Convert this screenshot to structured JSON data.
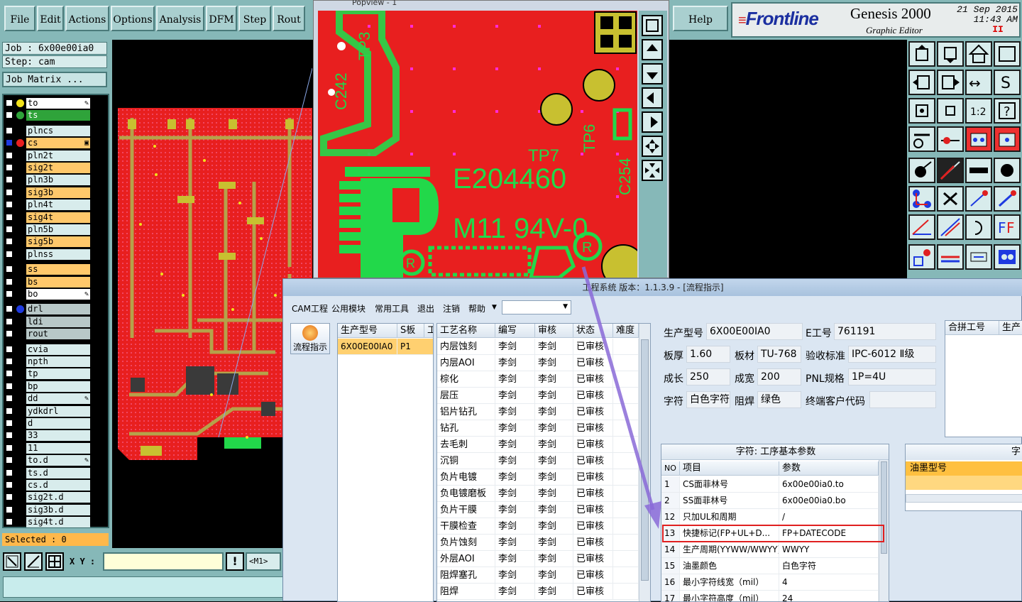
{
  "menu": {
    "items": [
      "File",
      "Edit",
      "Actions",
      "Options",
      "Analysis",
      "DFM",
      "Step",
      "Rout"
    ],
    "help": "Help"
  },
  "logo": {
    "brand_a": "Fr",
    "brand_b": "ontline",
    "product": "Genesis 2000",
    "subtitle": "Graphic Editor",
    "date": "21 Sep 2015",
    "time": "11:43 AM"
  },
  "job": {
    "job_label": "Job : 6x00e00ia0",
    "step_label": "Step: cam",
    "matrix_button": "Job Matrix ..."
  },
  "layers": [
    {
      "name": "to",
      "style": "hi",
      "dot": "#f2e21a",
      "flag": "✎"
    },
    {
      "name": "ts",
      "style": "tsb",
      "dot": "#2fa33a",
      "flag": ""
    },
    {
      "name": "plncs",
      "style": "pln",
      "dot": "",
      "flag": ""
    },
    {
      "name": "cs",
      "style": "sig",
      "dot": "#e81f1f",
      "flag": "▣",
      "active": true
    },
    {
      "name": "pln2t",
      "style": "pln",
      "dot": "",
      "flag": ""
    },
    {
      "name": "sig2t",
      "style": "sig",
      "dot": "",
      "flag": ""
    },
    {
      "name": "pln3b",
      "style": "pln",
      "dot": "",
      "flag": ""
    },
    {
      "name": "sig3b",
      "style": "sig",
      "dot": "",
      "flag": ""
    },
    {
      "name": "pln4t",
      "style": "pln",
      "dot": "",
      "flag": ""
    },
    {
      "name": "sig4t",
      "style": "sig",
      "dot": "",
      "flag": ""
    },
    {
      "name": "pln5b",
      "style": "pln",
      "dot": "",
      "flag": ""
    },
    {
      "name": "sig5b",
      "style": "sig",
      "dot": "",
      "flag": ""
    },
    {
      "name": "plnss",
      "style": "pln",
      "dot": "",
      "flag": ""
    },
    {
      "name": "ss",
      "style": "sig",
      "dot": "",
      "flag": ""
    },
    {
      "name": "bs",
      "style": "sig",
      "dot": "",
      "flag": ""
    },
    {
      "name": "bo",
      "style": "hi",
      "dot": "",
      "flag": "✎"
    },
    {
      "name": "drl",
      "style": "drl",
      "dot": "#1e3ae0",
      "flag": ""
    },
    {
      "name": "ldi",
      "style": "drl",
      "dot": "",
      "flag": ""
    },
    {
      "name": "rout",
      "style": "drl",
      "dot": "",
      "flag": ""
    },
    {
      "name": "cvia",
      "style": "pln",
      "dot": "",
      "flag": ""
    },
    {
      "name": "npth",
      "style": "pln",
      "dot": "",
      "flag": ""
    },
    {
      "name": "tp",
      "style": "pln",
      "dot": "",
      "flag": ""
    },
    {
      "name": "bp",
      "style": "pln",
      "dot": "",
      "flag": ""
    },
    {
      "name": "dd",
      "style": "pln",
      "dot": "",
      "flag": "✎"
    },
    {
      "name": "ydkdrl",
      "style": "pln",
      "dot": "",
      "flag": ""
    },
    {
      "name": "d",
      "style": "pln",
      "dot": "",
      "flag": ""
    },
    {
      "name": "33",
      "style": "pln",
      "dot": "",
      "flag": ""
    },
    {
      "name": "11",
      "style": "pln",
      "dot": "",
      "flag": ""
    },
    {
      "name": "to.d",
      "style": "pln",
      "dot": "",
      "flag": "✎"
    },
    {
      "name": "ts.d",
      "style": "pln",
      "dot": "",
      "flag": ""
    },
    {
      "name": "cs.d",
      "style": "pln",
      "dot": "",
      "flag": ""
    },
    {
      "name": "sig2t.d",
      "style": "pln",
      "dot": "",
      "flag": ""
    },
    {
      "name": "sig3b.d",
      "style": "pln",
      "dot": "",
      "flag": ""
    },
    {
      "name": "sig4t.d",
      "style": "pln",
      "dot": "",
      "flag": ""
    }
  ],
  "status": {
    "selected": "Selected : 0",
    "xy_label": "X Y :",
    "mode_label": "<M1>"
  },
  "popview": {
    "title": "Popview - 1",
    "board_text_1": "E204460",
    "board_text_2": "M11 94V-0",
    "refs": [
      "TP3",
      "C242",
      "TP7",
      "TP6",
      "C254"
    ]
  },
  "cam": {
    "title": "工程系统   版本：1.1.3.9 - [流程指示]",
    "menu": [
      "CAM工程",
      "公用模块",
      "常用工具",
      "退出",
      "注销",
      "帮助"
    ],
    "flow_button": "流程指示",
    "model_grid": {
      "headers": [
        "生产型号",
        "S板",
        "工"
      ],
      "rows": [
        [
          "6X00E00IA0",
          "P1"
        ]
      ]
    },
    "process_grid": {
      "headers": [
        "工艺名称",
        "编写",
        "审核",
        "状态",
        "难度"
      ],
      "rows": [
        [
          "内层蚀刻",
          "李剑",
          "李剑",
          "已审核"
        ],
        [
          "内层AOI",
          "李剑",
          "李剑",
          "已审核"
        ],
        [
          "棕化",
          "李剑",
          "李剑",
          "已审核"
        ],
        [
          "层压",
          "李剑",
          "李剑",
          "已审核"
        ],
        [
          "铝片钻孔",
          "李剑",
          "李剑",
          "已审核"
        ],
        [
          "钻孔",
          "李剑",
          "李剑",
          "已审核"
        ],
        [
          "去毛刺",
          "李剑",
          "李剑",
          "已审核"
        ],
        [
          "沉铜",
          "李剑",
          "李剑",
          "已审核"
        ],
        [
          "负片电镀",
          "李剑",
          "李剑",
          "已审核"
        ],
        [
          "负电镀磨板",
          "李剑",
          "李剑",
          "已审核"
        ],
        [
          "负片干膜",
          "李剑",
          "李剑",
          "已审核"
        ],
        [
          "干膜检查",
          "李剑",
          "李剑",
          "已审核"
        ],
        [
          "负片蚀刻",
          "李剑",
          "李剑",
          "已审核"
        ],
        [
          "外层AOI",
          "李剑",
          "李剑",
          "已审核"
        ],
        [
          "阻焊塞孔",
          "李剑",
          "李剑",
          "已审核"
        ],
        [
          "阻焊",
          "李剑",
          "李剑",
          "已审核"
        ]
      ]
    },
    "detail": {
      "prod_model_label": "生产型号",
      "prod_model": "6X00E00IA0",
      "e_no_label": "E工号",
      "e_no": "761191",
      "thick_label": "板厚",
      "thick": "1.60",
      "material_label": "板材",
      "material": "TU-768",
      "std_label": "验收标准",
      "std": "IPC-6012 Ⅱ级",
      "len_label": "成长",
      "len": "250",
      "wid_label": "成宽",
      "wid": "200",
      "pnl_label": "PNL规格",
      "pnl": "1P=4U",
      "char_label": "字符",
      "char": "白色字符",
      "mask_label": "阻焊",
      "mask": "绿色",
      "client_label": "终端客户代码",
      "client": ""
    },
    "merge_headers": [
      "合拼工号",
      "生产"
    ],
    "param_grid": {
      "title": "字符: 工序基本参数",
      "headers": [
        "NO",
        "项目",
        "参数"
      ],
      "rows": [
        [
          "1",
          "CS面菲林号",
          "6x00e00ia0.to"
        ],
        [
          "2",
          "SS面菲林号",
          "6x00e00ia0.bo"
        ],
        [
          "12",
          "只加UL和周期",
          "/"
        ],
        [
          "13",
          "快捷标记(FP+UL+D...",
          "FP+DATECODE"
        ],
        [
          "14",
          "生产周期(YYWW/WWYY)",
          "WWYY"
        ],
        [
          "15",
          "油墨颜色",
          "白色字符"
        ],
        [
          "16",
          "最小字符线宽（mil）",
          "4"
        ],
        [
          "17",
          "最小字符高度（mil）",
          "24"
        ]
      ]
    },
    "ink_panel": {
      "title": "字",
      "header": "油墨型号"
    }
  },
  "colors": {
    "genesis_bg": "#86b8b8",
    "pcb_red": "#e81f1f",
    "silk_green": "#22d84a",
    "signal_orange": "#ffc86b",
    "highlight_red": "#e02020"
  }
}
